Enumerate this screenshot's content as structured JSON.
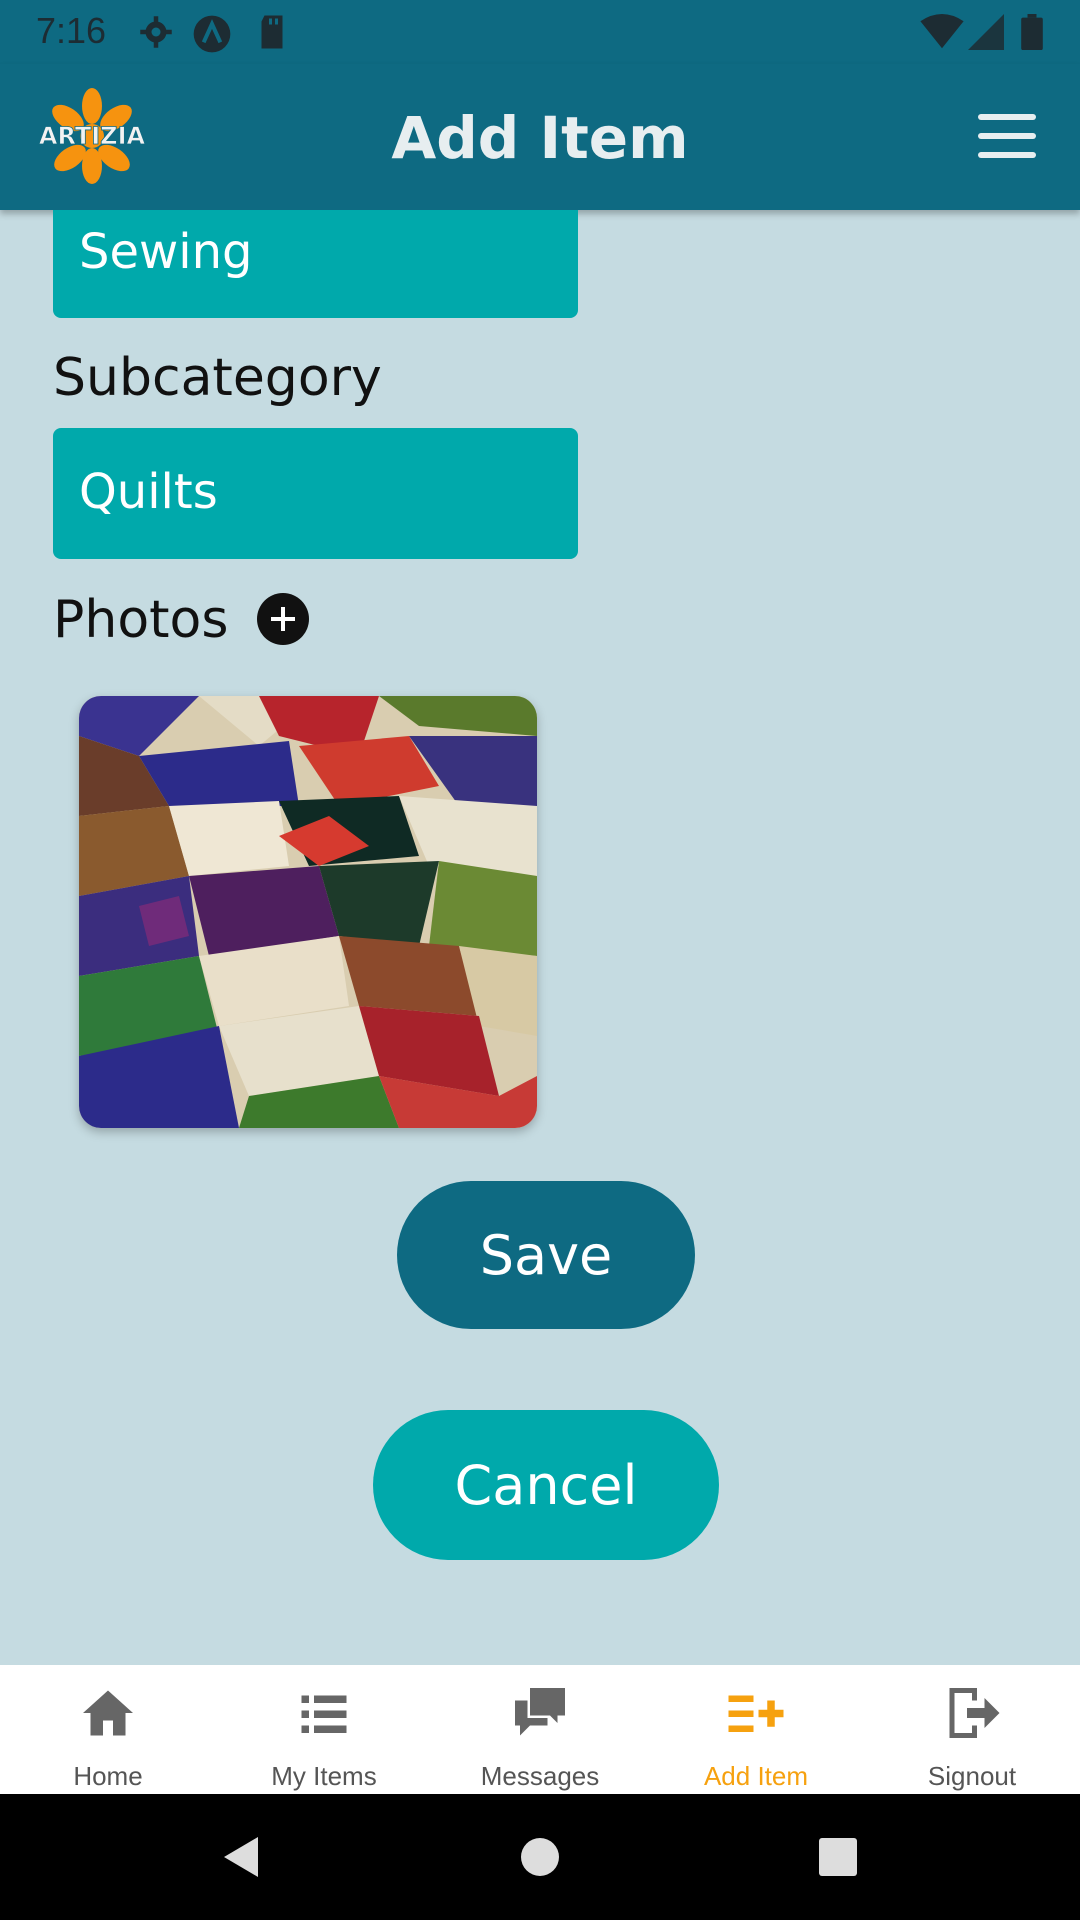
{
  "status_bar": {
    "time": "7:16",
    "icons": [
      "gear-icon",
      "a-icon",
      "sd-card-icon",
      "wifi-icon",
      "signal-icon",
      "battery-icon"
    ]
  },
  "app_bar": {
    "logo_text": "ARTIZIA",
    "title": "Add Item",
    "menu_icon": "hamburger-menu-icon"
  },
  "form": {
    "category_value": "Sewing",
    "subcategory_label": "Subcategory",
    "subcategory_value": "Quilts",
    "photos_label": "Photos",
    "add_photo_icon": "plus-circle-icon"
  },
  "buttons": {
    "save": "Save",
    "cancel": "Cancel"
  },
  "bottom_nav": {
    "items": [
      {
        "label": "Home",
        "icon": "home-icon"
      },
      {
        "label": "My Items",
        "icon": "list-icon"
      },
      {
        "label": "Messages",
        "icon": "messages-icon"
      },
      {
        "label": "Add Item",
        "icon": "add-list-icon"
      },
      {
        "label": "Signout",
        "icon": "signout-icon"
      }
    ],
    "active_index": 3
  },
  "colors": {
    "primary": "#0e6a82",
    "accent": "#00a9ab",
    "background": "#c5dbe1",
    "active_nav": "#f6a10f"
  }
}
